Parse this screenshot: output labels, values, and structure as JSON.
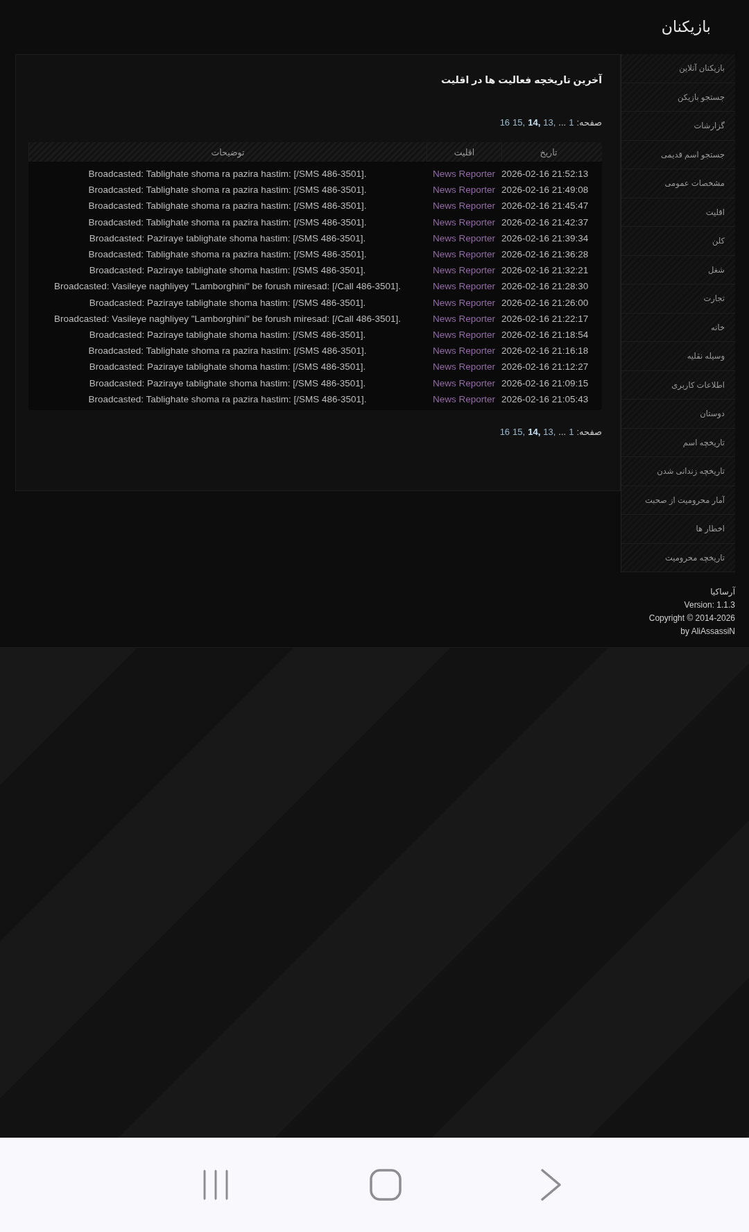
{
  "header": {
    "title": "بازیکنان"
  },
  "panel": {
    "title": "آخرین تاریخچه فعالیت ها در اقلیت",
    "pagination_top": {
      "label": "صفحه:",
      "items": [
        {
          "text": "1",
          "kind": "page",
          "selected": false
        },
        {
          "text": "...",
          "kind": "gap"
        },
        {
          "text": "13,",
          "kind": "page",
          "selected": false
        },
        {
          "text": "14,",
          "kind": "page",
          "selected": true
        },
        {
          "text": "15,",
          "kind": "page",
          "selected": false
        },
        {
          "text": "16",
          "kind": "page",
          "selected": false
        }
      ]
    },
    "table": {
      "columns": [
        "تاریخ",
        "اقلیت",
        "توضیحات"
      ],
      "rows": [
        {
          "date": "2026-02-16 21:52:13",
          "faction": "News Reporter",
          "description": "Broadcasted: Tablighate shoma ra pazira hastim: [/SMS 486-3501]."
        },
        {
          "date": "2026-02-16 21:49:08",
          "faction": "News Reporter",
          "description": "Broadcasted: Tablighate shoma ra pazira hastim: [/SMS 486-3501]."
        },
        {
          "date": "2026-02-16 21:45:47",
          "faction": "News Reporter",
          "description": "Broadcasted: Tablighate shoma ra pazira hastim: [/SMS 486-3501]."
        },
        {
          "date": "2026-02-16 21:42:37",
          "faction": "News Reporter",
          "description": "Broadcasted: Tablighate shoma ra pazira hastim: [/SMS 486-3501]."
        },
        {
          "date": "2026-02-16 21:39:34",
          "faction": "News Reporter",
          "description": "Broadcasted: Paziraye tablighate shoma hastim: [/SMS 486-3501]."
        },
        {
          "date": "2026-02-16 21:36:28",
          "faction": "News Reporter",
          "description": "Broadcasted: Tablighate shoma ra pazira hastim: [/SMS 486-3501]."
        },
        {
          "date": "2026-02-16 21:32:21",
          "faction": "News Reporter",
          "description": "Broadcasted: Paziraye tablighate shoma hastim: [/SMS 486-3501]."
        },
        {
          "date": "2026-02-16 21:28:30",
          "faction": "News Reporter",
          "description": "Broadcasted: Vasileye naghliyey \"Lamborghini\" be forush miresad: [/Call 486-3501]."
        },
        {
          "date": "2026-02-16 21:26:00",
          "faction": "News Reporter",
          "description": "Broadcasted: Paziraye tablighate shoma hastim: [/SMS 486-3501]."
        },
        {
          "date": "2026-02-16 21:22:17",
          "faction": "News Reporter",
          "description": "Broadcasted: Vasileye naghliyey \"Lamborghini\" be forush miresad: [/Call 486-3501]."
        },
        {
          "date": "2026-02-16 21:18:54",
          "faction": "News Reporter",
          "description": "Broadcasted: Paziraye tablighate shoma hastim: [/SMS 486-3501]."
        },
        {
          "date": "2026-02-16 21:16:18",
          "faction": "News Reporter",
          "description": "Broadcasted: Tablighate shoma ra pazira hastim: [/SMS 486-3501]."
        },
        {
          "date": "2026-02-16 21:12:27",
          "faction": "News Reporter",
          "description": "Broadcasted: Paziraye tablighate shoma hastim: [/SMS 486-3501]."
        },
        {
          "date": "2026-02-16 21:09:15",
          "faction": "News Reporter",
          "description": "Broadcasted: Paziraye tablighate shoma hastim: [/SMS 486-3501]."
        },
        {
          "date": "2026-02-16 21:05:43",
          "faction": "News Reporter",
          "description": "Broadcasted: Tablighate shoma ra pazira hastim: [/SMS 486-3501]."
        }
      ]
    },
    "pagination_bottom": {
      "label": "صفحه:",
      "items": [
        {
          "text": "1",
          "kind": "page",
          "selected": false
        },
        {
          "text": "...",
          "kind": "gap"
        },
        {
          "text": "13,",
          "kind": "page",
          "selected": false
        },
        {
          "text": "14,",
          "kind": "page",
          "selected": true
        },
        {
          "text": "15,",
          "kind": "page",
          "selected": false
        },
        {
          "text": "16",
          "kind": "page",
          "selected": false
        }
      ]
    }
  },
  "sidebar": {
    "items": [
      "بازیکنان آنلاین",
      "جستجو بازیکن",
      "گزارشات",
      "جستجو اسم قدیمی",
      "مشخصات عمومی",
      "اقلیت",
      "کلن",
      "شغل",
      "تجارت",
      "خانه",
      "وسیله نقلیه",
      "اطلاعات کاربری",
      "دوستان",
      "تاریخچه اسم",
      "تاریخچه زندانی شدن",
      "آمار محرومیت از صحبت",
      "اخطار ها",
      "تاریخچه محرومیت"
    ]
  },
  "footer": {
    "lines": [
      "آرساکیا",
      "Version: 1.1.3",
      "Copyright © 2014-2026",
      "by AliAssassiN"
    ]
  },
  "nav_bar": {
    "buttons": [
      {
        "kind": "recents"
      },
      {
        "kind": "home"
      },
      {
        "kind": "back"
      }
    ]
  }
}
